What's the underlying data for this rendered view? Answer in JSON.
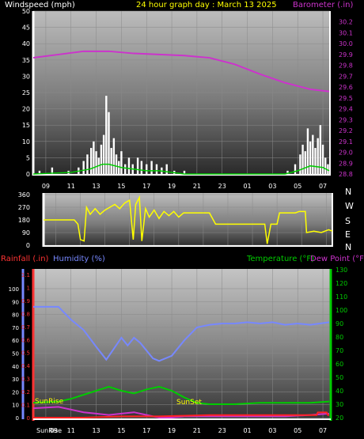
{
  "header": {
    "windspeed_label": "Windspeed (mph)",
    "title": "24 hour graph day : March 13 2025",
    "barometer_label": "Barometer (.in)"
  },
  "lower_header": {
    "rainfall_label": "Rainfall (.in)",
    "humidity_label": "Humidity (%)",
    "temperature_label": "Temperature (°F)",
    "dewpoint_label": "Dew Point (°F)"
  },
  "time_labels": [
    "09",
    "11",
    "13",
    "15",
    "17",
    "19",
    "21",
    "23",
    "01",
    "03",
    "05",
    "07"
  ],
  "bottom": {
    "sunrise_axis_label": "SunRise",
    "sunrise_marker": "SunRise",
    "sunset_marker": "SunSet"
  },
  "colors": {
    "wind": "#ffffff",
    "wind_avg": "#00cc00",
    "barometer": "#cc33cc",
    "wind_direction": "#ffff00",
    "rain": "#ff0000",
    "humidity": "#7788ff",
    "temperature": "#00cc00",
    "dewpoint": "#cc33cc",
    "title": "#ffff00"
  },
  "chart_data": [
    {
      "name": "windspeed-barometer",
      "type": "line",
      "x_hours": [
        8,
        10,
        12,
        14,
        16,
        18,
        20,
        22,
        24,
        26,
        28,
        30,
        31.5
      ],
      "tick_labels_x": [
        "09",
        "11",
        "13",
        "15",
        "17",
        "19",
        "21",
        "23",
        "01",
        "03",
        "05",
        "07"
      ],
      "y_left": {
        "label": "Windspeed (mph)",
        "ylim": [
          0,
          50
        ],
        "ticks": [
          0,
          5,
          10,
          15,
          20,
          25,
          30,
          35,
          40,
          45,
          50
        ]
      },
      "y_right": {
        "label": "Barometer (.in)",
        "ylim": [
          28.8,
          30.3
        ],
        "ticks": [
          28.8,
          28.9,
          29.0,
          29.1,
          29.2,
          29.3,
          29.4,
          29.5,
          29.6,
          29.7,
          29.8,
          29.9,
          30.0,
          30.1,
          30.2
        ]
      },
      "barometer": [
        29.87,
        29.9,
        29.93,
        29.93,
        29.91,
        29.9,
        29.89,
        29.87,
        29.81,
        29.72,
        29.64,
        29.58,
        29.56
      ],
      "wind_gusts": [
        [
          8.5,
          1
        ],
        [
          9.5,
          2
        ],
        [
          10.8,
          1
        ],
        [
          11.6,
          2
        ],
        [
          12.0,
          4
        ],
        [
          12.3,
          6
        ],
        [
          12.6,
          8
        ],
        [
          12.8,
          10
        ],
        [
          13.0,
          7
        ],
        [
          13.2,
          5
        ],
        [
          13.4,
          9
        ],
        [
          13.6,
          12
        ],
        [
          13.8,
          24
        ],
        [
          14.0,
          19
        ],
        [
          14.2,
          8
        ],
        [
          14.4,
          11
        ],
        [
          14.6,
          6
        ],
        [
          14.8,
          4
        ],
        [
          15.0,
          7
        ],
        [
          15.3,
          3
        ],
        [
          15.6,
          5
        ],
        [
          15.9,
          3
        ],
        [
          16.3,
          5
        ],
        [
          16.6,
          4
        ],
        [
          17.0,
          3
        ],
        [
          17.4,
          4
        ],
        [
          17.8,
          3
        ],
        [
          18.2,
          2
        ],
        [
          18.6,
          3
        ],
        [
          19.2,
          1
        ],
        [
          20.0,
          1
        ],
        [
          28.2,
          1
        ],
        [
          28.8,
          3
        ],
        [
          29.2,
          6
        ],
        [
          29.4,
          9
        ],
        [
          29.6,
          7
        ],
        [
          29.8,
          14
        ],
        [
          30.0,
          10
        ],
        [
          30.2,
          12
        ],
        [
          30.4,
          8
        ],
        [
          30.6,
          11
        ],
        [
          30.8,
          15
        ],
        [
          31.0,
          9
        ],
        [
          31.2,
          5
        ],
        [
          31.4,
          3
        ]
      ],
      "wind_avg": [
        [
          8,
          0
        ],
        [
          11,
          0.5
        ],
        [
          12.5,
          1.5
        ],
        [
          13.5,
          3
        ],
        [
          14,
          3
        ],
        [
          15,
          2
        ],
        [
          16,
          1.5
        ],
        [
          17,
          1
        ],
        [
          18,
          1
        ],
        [
          19,
          0.5
        ],
        [
          20,
          0
        ],
        [
          28,
          0
        ],
        [
          29,
          1
        ],
        [
          30,
          2.5
        ],
        [
          31,
          2
        ],
        [
          31.5,
          1
        ]
      ]
    },
    {
      "name": "wind-direction",
      "type": "line",
      "y_left": {
        "ticks": [
          0,
          90,
          180,
          270,
          360
        ],
        "ylim": [
          0,
          360
        ]
      },
      "y_right_labels": [
        "N",
        "W",
        "S",
        "E",
        "N"
      ],
      "direction": [
        [
          8,
          180
        ],
        [
          10.5,
          180
        ],
        [
          10.8,
          150
        ],
        [
          11.0,
          40
        ],
        [
          11.3,
          30
        ],
        [
          11.5,
          270
        ],
        [
          11.8,
          220
        ],
        [
          12.2,
          260
        ],
        [
          12.6,
          220
        ],
        [
          13.0,
          250
        ],
        [
          13.4,
          270
        ],
        [
          13.8,
          290
        ],
        [
          14.2,
          260
        ],
        [
          14.6,
          300
        ],
        [
          15.0,
          320
        ],
        [
          15.3,
          40
        ],
        [
          15.5,
          290
        ],
        [
          15.8,
          340
        ],
        [
          16.0,
          30
        ],
        [
          16.3,
          260
        ],
        [
          16.6,
          200
        ],
        [
          17.0,
          250
        ],
        [
          17.4,
          190
        ],
        [
          17.8,
          240
        ],
        [
          18.2,
          210
        ],
        [
          18.6,
          240
        ],
        [
          19.0,
          200
        ],
        [
          19.4,
          230
        ],
        [
          20.0,
          230
        ],
        [
          21.5,
          230
        ],
        [
          22.0,
          150
        ],
        [
          26.0,
          150
        ],
        [
          26.2,
          10
        ],
        [
          26.5,
          150
        ],
        [
          27.0,
          150
        ],
        [
          27.2,
          230
        ],
        [
          28.5,
          230
        ],
        [
          28.8,
          240
        ],
        [
          29.3,
          240
        ],
        [
          29.4,
          90
        ],
        [
          30.0,
          100
        ],
        [
          30.6,
          90
        ],
        [
          31.2,
          110
        ],
        [
          31.5,
          100
        ]
      ]
    },
    {
      "name": "rain-humidity-temperature",
      "type": "line",
      "y_left_rain": {
        "label": "Rainfall (.in)",
        "ylim": [
          0,
          1.2
        ],
        "ticks": [
          0,
          0.1,
          0.2,
          0.3,
          0.4,
          0.5,
          0.6,
          0.7,
          0.8,
          0.9,
          1.0,
          1.1
        ]
      },
      "y_left_humidity": {
        "label": "Humidity (%)",
        "ylim": [
          0,
          100
        ],
        "ticks": [
          0,
          10,
          20,
          30,
          40,
          50,
          60,
          70,
          80,
          90,
          100
        ]
      },
      "y_right_temp": {
        "label": "Temperature (°F)",
        "ylim": [
          20,
          130
        ],
        "ticks": [
          20,
          30,
          40,
          50,
          60,
          70,
          80,
          90,
          100,
          110,
          120,
          130
        ]
      },
      "humidity": [
        [
          8,
          86
        ],
        [
          10,
          86
        ],
        [
          11,
          76
        ],
        [
          12,
          68
        ],
        [
          13,
          55
        ],
        [
          13.8,
          45
        ],
        [
          14.3,
          52
        ],
        [
          15,
          62
        ],
        [
          15.5,
          56
        ],
        [
          16,
          62
        ],
        [
          16.5,
          58
        ],
        [
          17,
          52
        ],
        [
          17.5,
          46
        ],
        [
          18,
          44
        ],
        [
          19,
          48
        ],
        [
          20,
          60
        ],
        [
          21,
          70
        ],
        [
          22,
          72
        ],
        [
          23,
          73
        ],
        [
          24,
          73
        ],
        [
          25,
          74
        ],
        [
          26,
          73
        ],
        [
          27,
          74
        ],
        [
          28,
          72
        ],
        [
          29,
          73
        ],
        [
          30,
          72
        ],
        [
          31.5,
          74
        ]
      ],
      "temperature": [
        [
          8,
          31
        ],
        [
          10,
          32
        ],
        [
          11,
          34
        ],
        [
          12,
          37
        ],
        [
          13,
          40
        ],
        [
          14,
          43
        ],
        [
          15,
          40
        ],
        [
          16,
          38
        ],
        [
          17,
          41
        ],
        [
          18,
          43
        ],
        [
          19,
          40
        ],
        [
          20,
          35
        ],
        [
          21,
          31
        ],
        [
          22,
          30
        ],
        [
          24,
          30
        ],
        [
          26,
          31
        ],
        [
          28,
          31
        ],
        [
          30,
          31
        ],
        [
          31.5,
          32
        ]
      ],
      "dew_point": [
        [
          8,
          27
        ],
        [
          10,
          28
        ],
        [
          11,
          26
        ],
        [
          12,
          24
        ],
        [
          13,
          23
        ],
        [
          14,
          22
        ],
        [
          15,
          23
        ],
        [
          16,
          24
        ],
        [
          17,
          22
        ],
        [
          18,
          20
        ],
        [
          19,
          20
        ],
        [
          20,
          21
        ],
        [
          22,
          21
        ],
        [
          24,
          21
        ],
        [
          26,
          21
        ],
        [
          28,
          21
        ],
        [
          30,
          22
        ],
        [
          31.5,
          23
        ]
      ],
      "rainfall": [
        [
          8,
          0.0
        ],
        [
          12,
          0.0
        ],
        [
          15,
          0.01
        ],
        [
          18,
          0.01
        ],
        [
          22,
          0.02
        ],
        [
          26,
          0.02
        ],
        [
          28,
          0.02
        ],
        [
          30.5,
          0.02
        ],
        [
          30.6,
          0.04
        ],
        [
          31.3,
          0.04
        ],
        [
          31.4,
          0.02
        ],
        [
          31.5,
          0.02
        ]
      ]
    }
  ]
}
